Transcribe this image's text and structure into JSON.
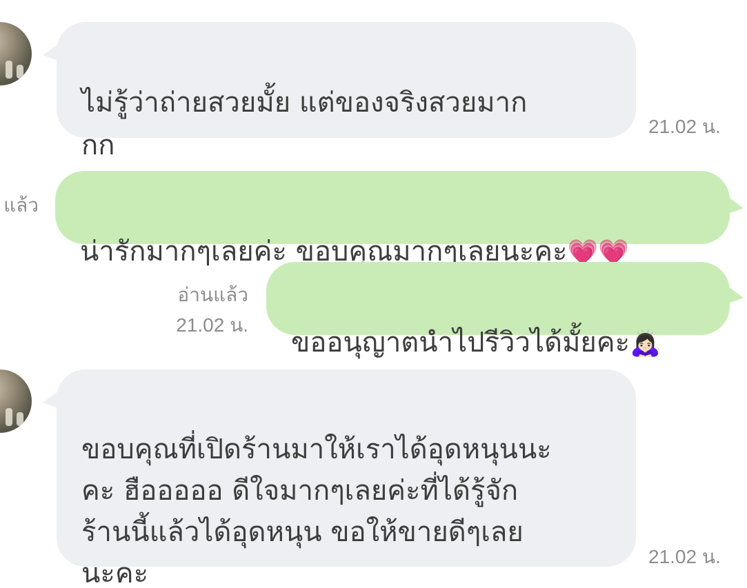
{
  "messages": [
    {
      "direction": "incoming",
      "text": "ไม่รู้ว่าถ่ายสวยมั้ย แต่ของจริงสวยมาก\nกก",
      "time": "21.02 น."
    },
    {
      "direction": "outgoing",
      "text": "น่ารักมากๆเลยค่ะ ขอบคุณมากๆเลยนะคะ",
      "emoji": "💗💗",
      "read_status": "แล้ว"
    },
    {
      "direction": "outgoing",
      "text": "ขออนุญาตนำไปรีวิวได้มั้ยคะ",
      "emoji": "🙇🏻‍♀️",
      "read_status": "อ่านแล้ว",
      "time": "21.02 น."
    },
    {
      "direction": "incoming",
      "text": "ขอบคุณที่เปิดร้านมาให้เราได้อุดหนุนนะ\nคะ ฮือออออ ดีใจมากๆเลยค่ะที่ได้รู้จัก\nร้านนี้แล้วได้อุดหนุน ขอให้ขายดีๆเลย\nนะคะ",
      "time": "21.02 น."
    }
  ],
  "colors": {
    "incoming_bubble": "#eeeff2",
    "outgoing_bubble": "#c9ecb7",
    "text": "#3d3d3d",
    "meta": "#8d8d8d"
  }
}
